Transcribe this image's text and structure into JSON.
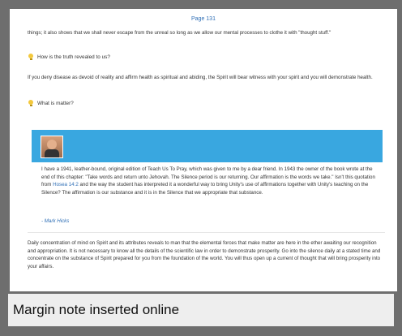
{
  "page": {
    "number": "Page 131",
    "para1": "things; it also shows that we shall never escape from the unreal so long as we allow our mental processes to clothe it with \"thought stuff.\"",
    "q1": "How is the truth revealed to us?",
    "para2": "If you deny disease as devoid of reality and affirm health as spiritual and abiding, the Spirit will bear witness with your spirit and you will demonstrate health.",
    "q2": "What is matter?",
    "note_part1": "I have a 1941, leather-bound, original edition of Teach Us To Pray, which was given to me by a dear friend. In 1943 the owner of the book wrote at the end of this chapter: \"Take words and return unto Jehovah. The Silence period is our returning. Our affirmation is the words we take.\" Isn't this quotation from ",
    "note_link": "Hosea 14:2",
    "note_part2": " and the way the student has interpreted it a wonderful way to bring Unity's use of affirmations together with Unity's teaching on the Silence? The affirmation is our substance and it is in the Silence that we appropriate that substance.",
    "author": "- Mark Hicks",
    "para3": "Daily concentration of mind on Spirit and its attributes reveals to man that the elemental forces that make matter are here in the ether awaiting our recognition and appropriation. It is not necessary to know all the details of the scientific law in order to demonstrate prosperity. Go into the silence daily at a stated time and concentrate on the substance of Spirit prepared for you from the foundation of the world. You will thus open up a current of thought that will bring prosperity into your affairs."
  },
  "caption": "Margin note inserted online",
  "colors": {
    "accent_box": "#39a7e0",
    "link": "#2f6fb6"
  },
  "icons": [
    "lightbulb-icon",
    "lightbulb-icon",
    "author-avatar"
  ]
}
